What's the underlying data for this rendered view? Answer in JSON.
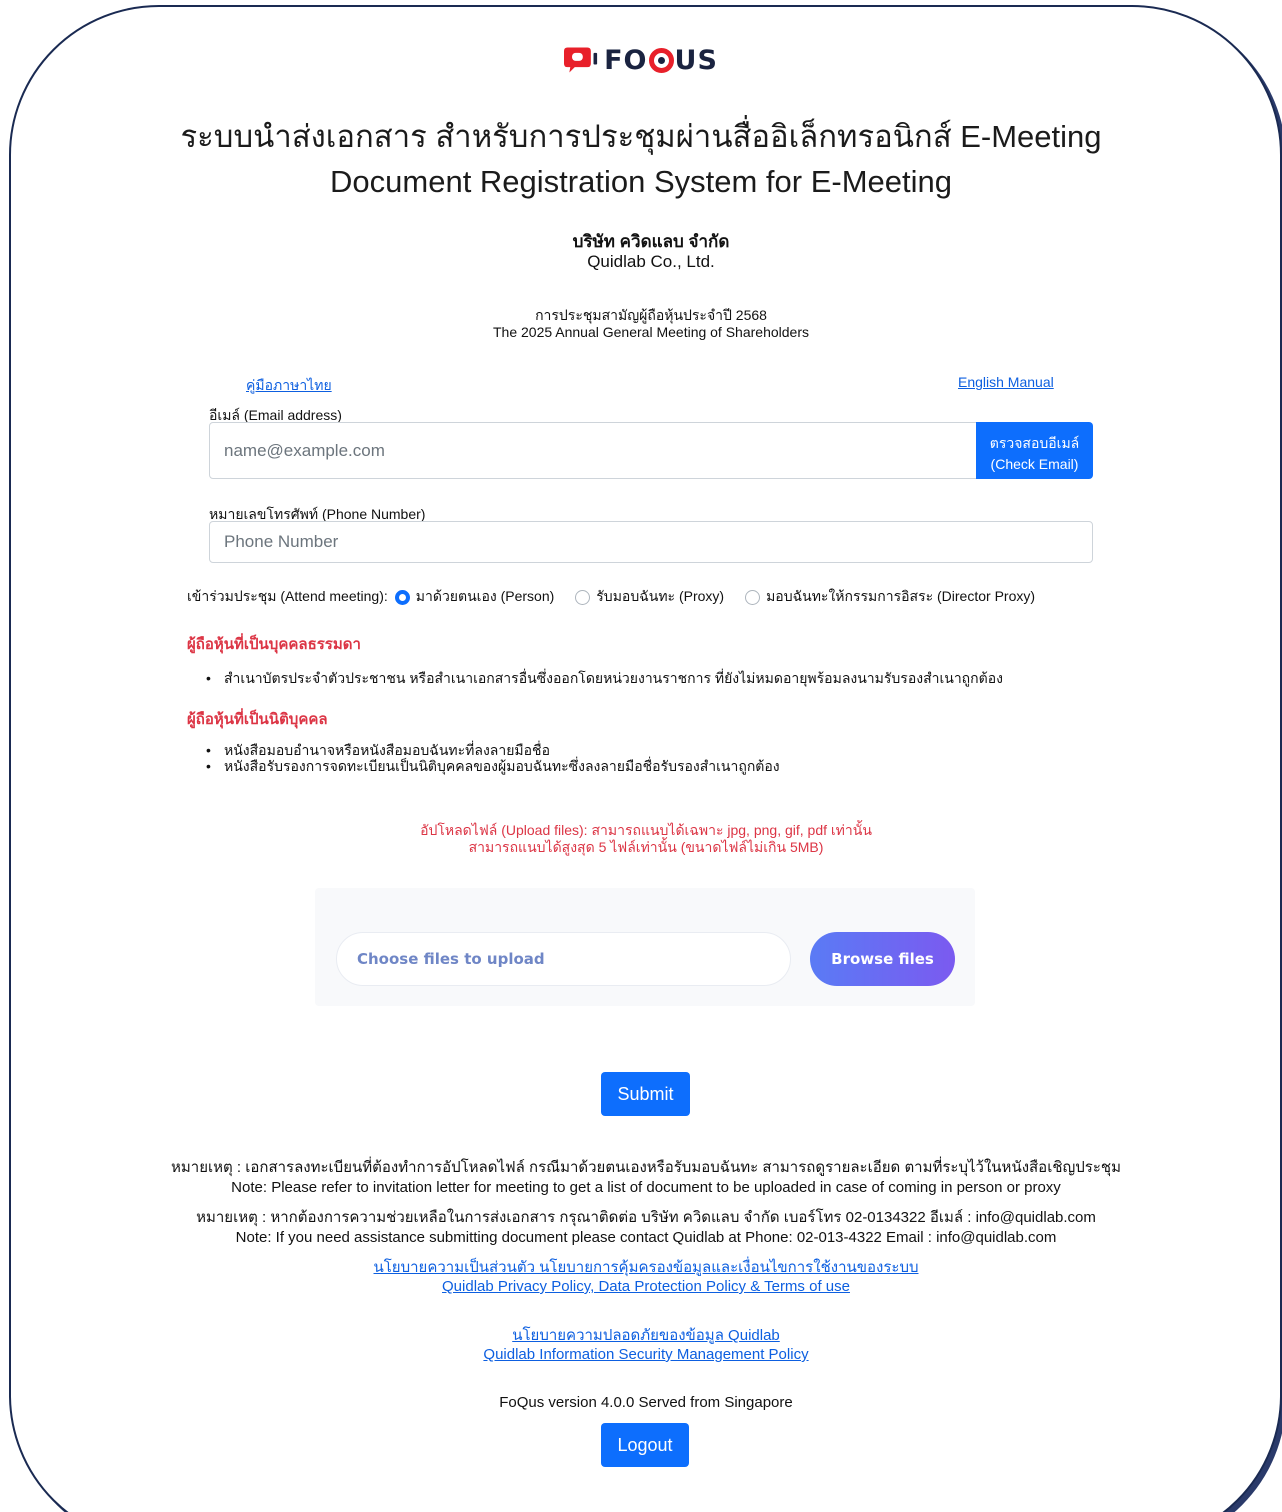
{
  "brand": {
    "name_prefix": "FO",
    "name_suffix": "US",
    "accent_color": "#e8202a",
    "dark_color": "#1a2340"
  },
  "header": {
    "title_th": "ระบบนำส่งเอกสาร สำหรับการประชุมผ่านสื่ออิเล็กทรอนิกส์ E-Meeting",
    "title_en": "Document Registration System for E-Meeting",
    "company_th": "บริษัท ควิดแลบ จำกัด",
    "company_en": "Quidlab Co., Ltd.",
    "meeting_th": "การประชุมสามัญผู้ถือหุ้นประจำปี 2568",
    "meeting_en": "The 2025 Annual General Meeting of Shareholders"
  },
  "manuals": {
    "thai": "คู่มือภาษาไทย",
    "english": "English Manual"
  },
  "form": {
    "email_label": "อีเมล์ (Email address)",
    "email_placeholder": "name@example.com",
    "check_email_line1": "ตรวจสอบอีเมล์",
    "check_email_line2": "(Check Email)",
    "phone_label": "หมายเลขโทรศัพท์ (Phone Number)",
    "phone_placeholder": "Phone Number",
    "attend_label": "เข้าร่วมประชุม (Attend meeting):",
    "attend_options": [
      {
        "label": "มาด้วยตนเอง (Person)",
        "selected": true
      },
      {
        "label": "รับมอบฉันทะ (Proxy)",
        "selected": false
      },
      {
        "label": "มอบฉันทะให้กรรมการอิสระ (Director Proxy)",
        "selected": false
      }
    ]
  },
  "requirements": {
    "individual_heading": "ผู้ถือหุ้นที่เป็นบุคคลธรรมดา",
    "individual_items": [
      "สำเนาบัตรประจำตัวประชาชน หรือสำเนาเอกสารอื่นซึ่งออกโดยหน่วยงานราชการ ที่ยังไม่หมดอายุพร้อมลงนามรับรองสำเนาถูกต้อง"
    ],
    "juristic_heading": "ผู้ถือหุ้นที่เป็นนิติบุคคล",
    "juristic_items": [
      "หนังสือมอบอำนาจหรือหนังสือมอบฉันทะที่ลงลายมือชื่อ",
      "หนังสือรับรองการจดทะเบียนเป็นนิติบุคคลของผู้มอบฉันทะซึ่งลงลายมือชื่อรับรองสำเนาถูกต้อง"
    ]
  },
  "upload": {
    "note_line1": "อัปโหลดไฟล์ (Upload files): สามารถแนบได้เฉพาะ jpg, png, gif, pdf เท่านั้น",
    "note_line2": "สามารถแนบได้สูงสุด 5 ไฟล์เท่านั้น (ขนาดไฟล์ไม่เกิน 5MB)",
    "field_placeholder": "Choose files to upload",
    "browse_label": "Browse files"
  },
  "submit_label": "Submit",
  "notes": {
    "note1_th": "หมายเหตุ : เอกสารลงทะเบียนที่ต้องทำการอัปโหลดไฟล์ กรณีมาด้วยตนเองหรือรับมอบฉันทะ สามารถดูรายละเอียด ตามที่ระบุไว้ในหนังสือเชิญประชุม",
    "note1_en": "Note: Please refer to invitation letter for meeting to get a list of document to be uploaded in case of coming in person or proxy",
    "note2_th": "หมายเหตุ : หากต้องการความช่วยเหลือในการส่งเอกสาร กรุณาติดต่อ บริษัท ควิดแลบ จำกัด เบอร์โทร 02-0134322 อีเมล์ : info@quidlab.com",
    "note2_en": "Note: If you need assistance submitting document please contact Quidlab at Phone: 02-013-4322 Email : info@quidlab.com"
  },
  "policies": {
    "privacy_th": "นโยบายความเป็นส่วนตัว นโยบายการคุ้มครองข้อมูลและเงื่อนไขการใช้งานของระบบ",
    "privacy_en": "Quidlab Privacy Policy, Data Protection Policy & Terms of use",
    "security_th": "นโยบายความปลอดภัยของข้อมูล Quidlab",
    "security_en": "Quidlab Information Security Management Policy"
  },
  "version_text": "FoQus version 4.0.0 Served from Singapore",
  "logout_label": "Logout"
}
